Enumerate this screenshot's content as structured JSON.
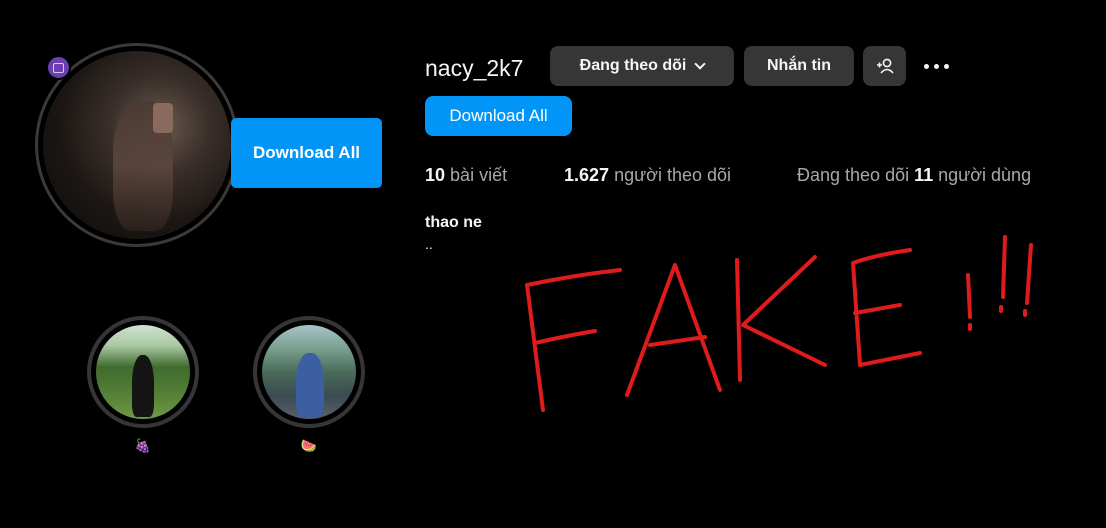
{
  "profile": {
    "username": "nacy_2k7",
    "full_name": "thao ne",
    "bio": ".."
  },
  "actions": {
    "download_all_big": "Download All",
    "following_label": "Đang theo dõi",
    "message_label": "Nhắn tin",
    "download_all_small": "Download All"
  },
  "stats": {
    "posts_count": "10",
    "posts_label": "bài viết",
    "followers_count": "1.627",
    "followers_label": "người theo dõi",
    "following_prefix": "Đang theo dõi",
    "following_count": "11",
    "following_suffix": "người dùng"
  },
  "highlights": [
    {
      "label": "🍇"
    },
    {
      "label": "🍉"
    }
  ],
  "overlay": {
    "handwritten_text": "FAKE !!!",
    "color": "#e01b1b"
  },
  "colors": {
    "background": "#000000",
    "primary_button": "#0095f6",
    "secondary_button": "#363636",
    "muted_text": "#a8a8a8"
  },
  "icons": [
    "avatar-badge-icon",
    "chevron-down-icon",
    "add-person-icon",
    "more-options-icon"
  ]
}
